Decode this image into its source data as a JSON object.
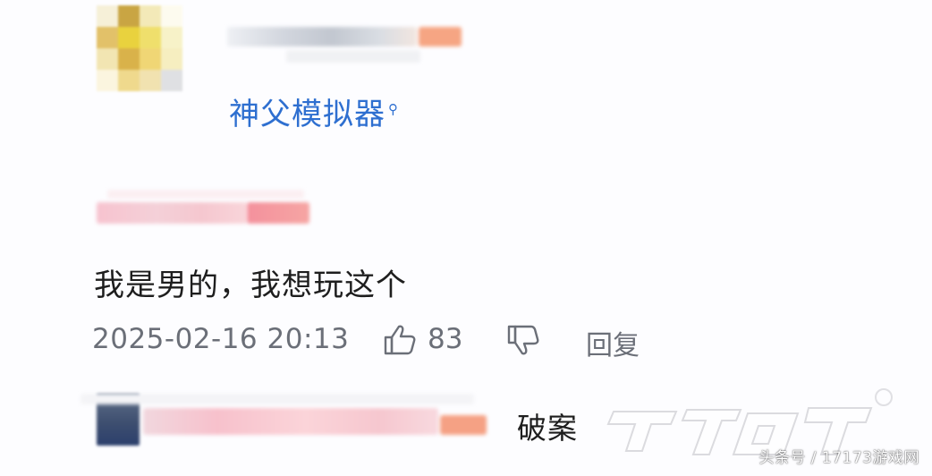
{
  "post": {
    "search_link_text": "神父模拟器",
    "search_icon": "search-icon"
  },
  "comment": {
    "text": "我是男的，我想玩这个",
    "timestamp": "2025-02-16 20:13",
    "like_count": "83",
    "reply_label": "回复"
  },
  "reply": {
    "text": "破案"
  },
  "watermark": {
    "text": "头条号 / 17173游戏网"
  },
  "colors": {
    "link": "#2e6fd0",
    "meta": "#6b6f78"
  }
}
